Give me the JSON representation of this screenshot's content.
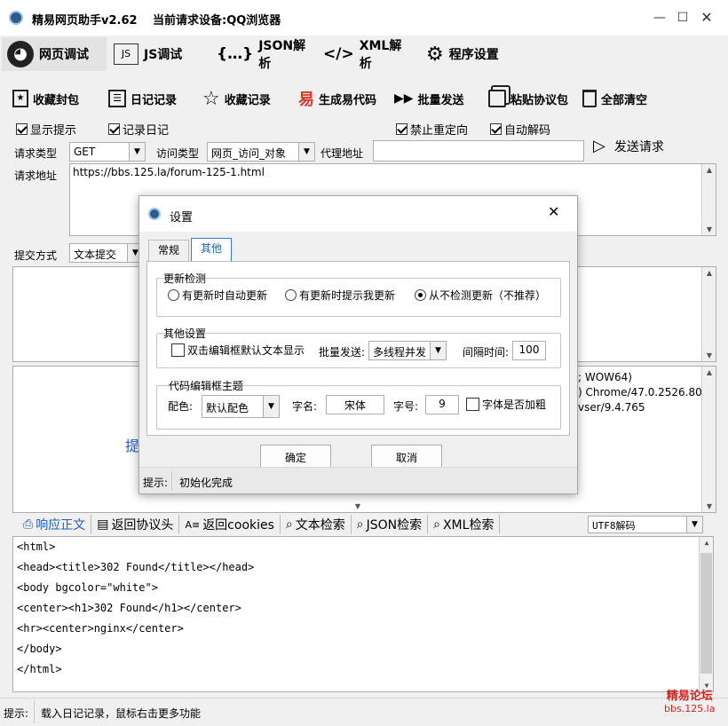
{
  "window": {
    "title": "精易网页助手v2.62",
    "current_device_label": "当前请求设备:QQ浏览器"
  },
  "main_tabs": [
    {
      "label": "网页调试",
      "icon": "globe-icon"
    },
    {
      "label": "JS调试",
      "icon": "js-icon"
    },
    {
      "label": "JSON解析",
      "icon": "braces-icon"
    },
    {
      "label": "XML解析",
      "icon": "code-brackets-icon"
    },
    {
      "label": "程序设置",
      "icon": "gear-icon"
    }
  ],
  "toolbar": [
    {
      "label": "收藏封包",
      "icon": "bookmark-icon"
    },
    {
      "label": "日记记录",
      "icon": "list-icon"
    },
    {
      "label": "收藏记录",
      "icon": "star-icon"
    },
    {
      "label": "生成易代码",
      "icon": "yi-icon"
    },
    {
      "label": "批量发送",
      "icon": "fast-forward-icon"
    },
    {
      "label": "粘贴协议包",
      "icon": "paste-icon"
    },
    {
      "label": "全部清空",
      "icon": "trash-icon"
    }
  ],
  "options": {
    "show_tips": "显示提示",
    "record_log": "记录日记",
    "no_redirect": "禁止重定向",
    "auto_decode": "自动解码"
  },
  "request": {
    "type_label": "请求类型",
    "type_value": "GET",
    "access_label": "访问类型",
    "access_value": "网页_访问_对象",
    "proxy_label": "代理地址",
    "proxy_value": "",
    "send_label": "发送请求",
    "url_label": "请求地址",
    "url_value": "https://bbs.125.la/forum-125-1.html",
    "submit_label": "提交方式",
    "submit_value": "文本提交"
  },
  "headers_partial": [
    "; WOW64)",
    ") Chrome/47.0.2526.80",
    "vser/9.4.765"
  ],
  "left_partial_char": "提",
  "response_tabs": [
    {
      "label": "响应正文",
      "icon": "response-icon"
    },
    {
      "label": "返回协议头",
      "icon": "doc-icon"
    },
    {
      "label": "返回cookies",
      "icon": "cookie-icon"
    },
    {
      "label": "文本检索",
      "icon": "search-icon"
    },
    {
      "label": "JSON检索",
      "icon": "search-icon"
    },
    {
      "label": "XML检索",
      "icon": "search-icon"
    }
  ],
  "encoding": "UTF8解码",
  "response_body": [
    "<html>",
    "<head><title>302 Found</title></head>",
    "<body bgcolor=\"white\">",
    "<center><h1>302 Found</h1></center>",
    "<hr><center>nginx</center>",
    "</body>",
    "</html>"
  ],
  "status": {
    "label": "提示:",
    "text": "载入日记记录，鼠标右击更多功能"
  },
  "watermark": {
    "line1": "精易论坛",
    "line2": "bbs.125.la"
  },
  "dialog": {
    "title": "设置",
    "tabs": [
      "常规",
      "其他"
    ],
    "update_group": "更新检测",
    "update_options": [
      "有更新时自动更新",
      "有更新时提示我更新",
      "从不检测更新（不推荐）"
    ],
    "other_group": "其他设置",
    "dbl_click_label": "双击编辑框默认文本显示",
    "batch_label": "批量发送:",
    "batch_value": "多线程并发",
    "interval_label": "间隔时间:",
    "interval_value": "100",
    "theme_group": "代码编辑框主题",
    "color_label": "配色:",
    "color_value": "默认配色",
    "font_label": "字名:",
    "font_value": "宋体",
    "size_label": "字号:",
    "size_value": "9",
    "bold_label": "字体是否加粗",
    "ok": "确定",
    "cancel": "取消",
    "status_label": "提示:",
    "status_text": "初始化完成"
  }
}
